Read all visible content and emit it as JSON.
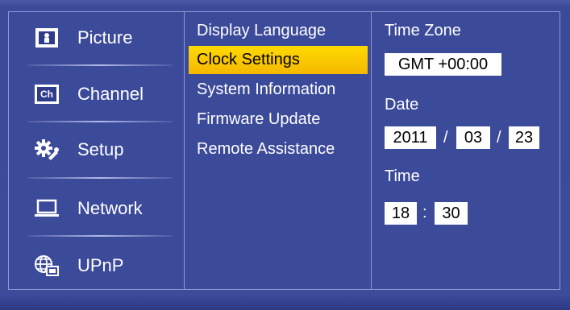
{
  "nav": {
    "items": [
      {
        "label": "Picture",
        "icon": "picture-icon",
        "icon_text": ""
      },
      {
        "label": "Channel",
        "icon": "channel-icon",
        "icon_text": "Ch"
      },
      {
        "label": "Setup",
        "icon": "gear-wrench-icon"
      },
      {
        "label": "Network",
        "icon": "laptop-icon"
      },
      {
        "label": "UPnP",
        "icon": "globe-device-icon"
      }
    ]
  },
  "submenu": {
    "items": [
      {
        "label": "Display Language"
      },
      {
        "label": "Clock Settings",
        "selected": true
      },
      {
        "label": "System Information"
      },
      {
        "label": "Firmware Update"
      },
      {
        "label": "Remote Assistance"
      }
    ]
  },
  "clock": {
    "time_zone_label": "Time Zone",
    "time_zone_value": "GMT +00:00",
    "date_label": "Date",
    "date_year": "2011",
    "date_month": "03",
    "date_day": "23",
    "date_separator": "/",
    "time_label": "Time",
    "time_hour": "18",
    "time_minute": "30",
    "time_separator": ":"
  },
  "colors": {
    "background": "#3c4a9a",
    "highlight": "#ffd200",
    "text": "#ffffff",
    "field_bg": "#ffffff"
  }
}
